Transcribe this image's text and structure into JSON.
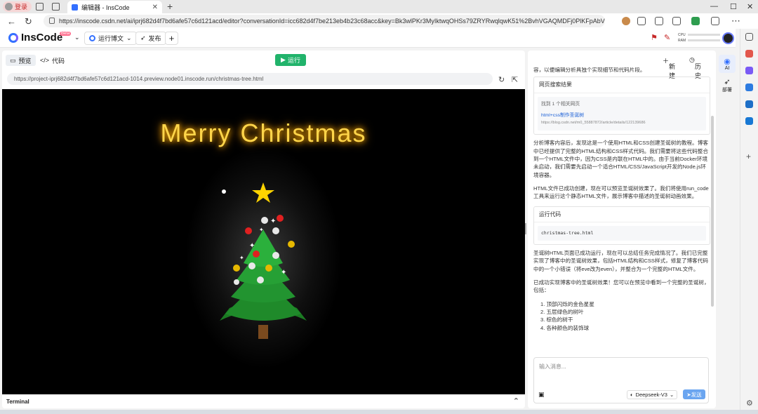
{
  "browser": {
    "profile_label": "登录",
    "tab_title": "编辑器 - InsCode",
    "url": "https://inscode.csdn.net/ai/iprj682d4f7bd6afe57c6d121acd/editor?conversationId=icc682d4f7be213eb4b23c68acc&key=Bk3wlPKr3MyIktwqOHSs79ZRYRwqlqwK51%2BvhVGAQMDFj0PlKFpAbV1CybN0XuPOoeZLE..."
  },
  "app": {
    "logo": "InsCode",
    "beta": "Beta",
    "project_btn": "运行博文",
    "publish_btn": "发布",
    "add_btn": "+",
    "cpu_label": "CPU",
    "ram_label": "RAM"
  },
  "left": {
    "tab_preview": "预览",
    "tab_code": "代码",
    "run": "运行",
    "preview_url": "https://project-iprj682d4f7bd6afe57c6d121acd-1014.preview.node01.inscode.run/christmas-tree.html",
    "greeting": "Merry Christmas",
    "terminal": "Terminal"
  },
  "right": {
    "new_btn": "新建",
    "history_btn": "历史",
    "cut_text": "容，以便编辑分析具独个实现细节和代码片段。",
    "search_card_title": "网页搜索结果",
    "search_found": "找到 1 个相关网页",
    "search_link": "html+css制作圣诞树",
    "search_url": "https://blog.csdn.net/m0_55887872/article/details/122139686",
    "para1": "分析博客内容后，发现这是一个使用HTML和CSS创建圣诞树的教程。博客中已经提供了完整的HTML结构和CSS样式代码。我们需要将这些代码整合到一个HTML文件中，因为CSS是内联在HTML中的。由于当前Docker环境未启动，我们需要先启动一个适合HTML/CSS/JavaScript开发的Node.js环境容器。",
    "para2": "HTML文件已成功创建，现在可以预览圣诞树效果了。我们将使用run_code工具来运行这个静态HTML文件，展示博客中描述的圣诞树动画效果。",
    "run_card_title": "运行代码",
    "run_file": "christmas-tree.html",
    "para3": "圣诞树HTML页面已成功运行，现在可以总结任务完成情况了。我们已完整实现了博客中的圣诞树效果，包括HTML结构和CSS样式，修复了博客代码中的一个小错误（将eve改为even），并整合为一个完整的HTML文件。",
    "para4": "已成功实现博客中的圣诞树效果！您可以在预览中看到一个完整的圣诞树，包括：",
    "list": [
      "1. 顶部闪烁的金色星星",
      "2. 五层绿色的树叶",
      "3. 棕色的树干",
      "4. 各种颜色的装饰球"
    ],
    "input_placeholder": "输入消息...",
    "model": "Deepseek-V3",
    "send": "发送"
  },
  "sidebar": {
    "ai": "AI",
    "deploy": "部署"
  }
}
